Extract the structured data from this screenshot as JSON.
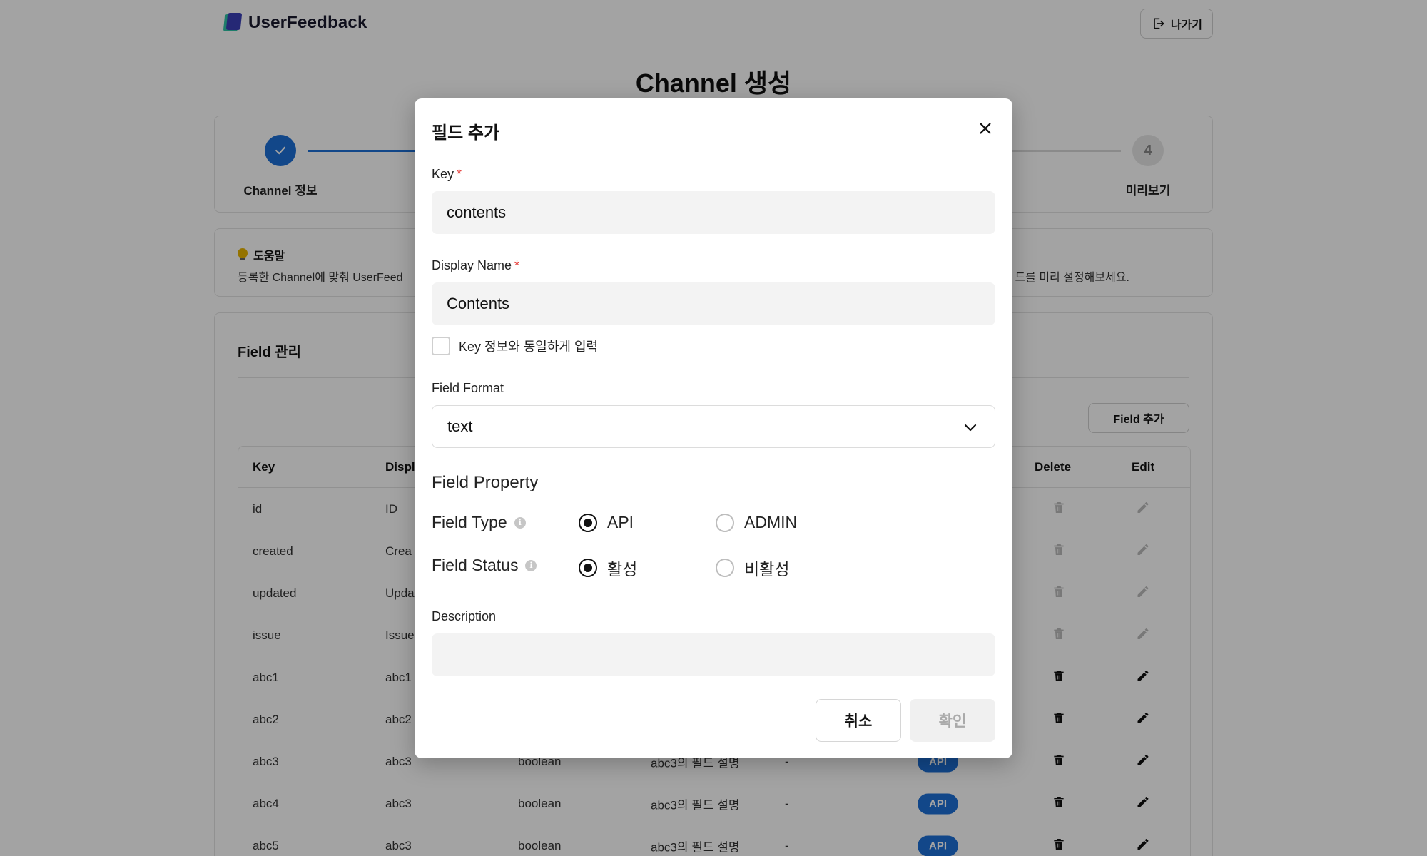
{
  "app": {
    "brand": "UserFeedback",
    "exit_label": "나가기"
  },
  "page": {
    "title": "Channel 생성"
  },
  "stepper": {
    "first_label": "Channel 정보",
    "last_number": "4",
    "last_label": "미리보기"
  },
  "help": {
    "title": "도움말",
    "text_left": "등록한 Channel에 맞춰 UserFeed",
    "text_right": "드를 미리 설정해보세요."
  },
  "field_mgmt": {
    "title": "Field 관리",
    "add_button": "Field 추가",
    "columns": {
      "key": "Key",
      "display": "Displ",
      "delete": "Delete",
      "edit": "Edit"
    },
    "rows": [
      {
        "key": "id",
        "name": "ID",
        "format": "",
        "desc": "",
        "opt": "",
        "type": "",
        "editable": false
      },
      {
        "key": "created",
        "name": "Crea",
        "format": "",
        "desc": "",
        "opt": "",
        "type": "",
        "editable": false
      },
      {
        "key": "updated",
        "name": "Upda",
        "format": "",
        "desc": "",
        "opt": "",
        "type": "",
        "editable": false
      },
      {
        "key": "issue",
        "name": "Issue",
        "format": "",
        "desc": "",
        "opt": "",
        "type": "",
        "editable": false
      },
      {
        "key": "abc1",
        "name": "abc1",
        "format": "",
        "desc": "",
        "opt": "",
        "type": "",
        "editable": true
      },
      {
        "key": "abc2",
        "name": "abc2",
        "format": "",
        "desc": "",
        "opt": "",
        "type": "",
        "editable": true
      },
      {
        "key": "abc3",
        "name": "abc3",
        "format": "boolean",
        "desc": "abc3의 필드 설명",
        "opt": "-",
        "type": "API",
        "editable": true
      },
      {
        "key": "abc4",
        "name": "abc3",
        "format": "boolean",
        "desc": "abc3의 필드 설명",
        "opt": "-",
        "type": "API",
        "editable": true
      },
      {
        "key": "abc5",
        "name": "abc3",
        "format": "boolean",
        "desc": "abc3의 필드 설명",
        "opt": "-",
        "type": "API",
        "editable": true
      }
    ]
  },
  "modal": {
    "title": "필드 추가",
    "key_label": "Key",
    "key_value": "contents",
    "display_name_label": "Display Name",
    "display_name_value": "Contents",
    "required_mark": "*",
    "same_as_key_label": "Key 정보와 동일하게 입력",
    "field_format_label": "Field Format",
    "field_format_value": "text",
    "field_property_title": "Field Property",
    "field_type_label": "Field Type",
    "field_type_options": [
      "API",
      "ADMIN"
    ],
    "field_type_selected": "API",
    "field_status_label": "Field Status",
    "field_status_options": [
      "활성",
      "비활성"
    ],
    "field_status_selected": "활성",
    "description_label": "Description",
    "description_value": "",
    "info_glyph": "i",
    "cancel_label": "취소",
    "confirm_label": "확인"
  },
  "colors": {
    "accent": "#1d6fd6",
    "required": "#e53935",
    "overlay": "rgba(0,0,0,0.36)"
  }
}
